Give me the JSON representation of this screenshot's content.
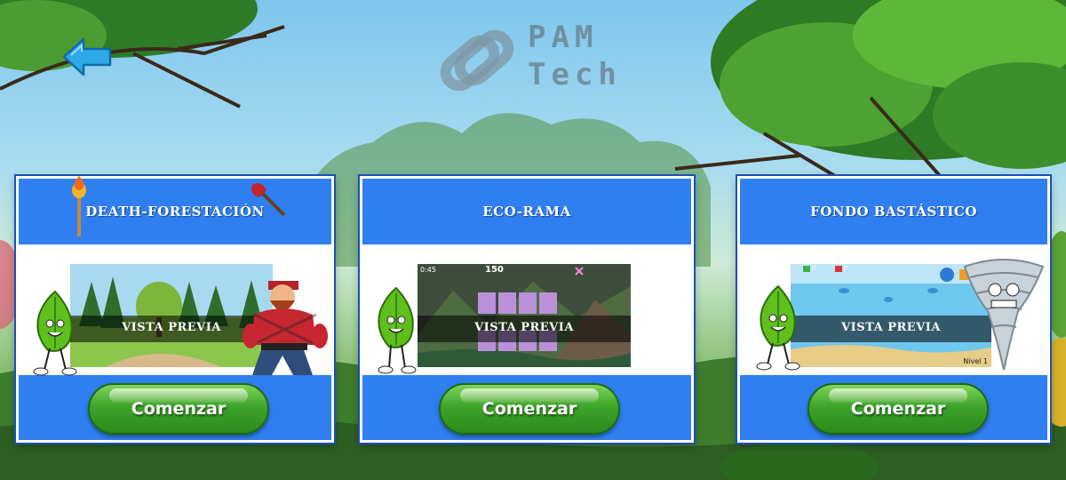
{
  "logo": {
    "line1": "PAM",
    "line2": "Tech"
  },
  "back_icon": "left-arrow-icon",
  "games": [
    {
      "title": "DEATH-FORESTACIÓN",
      "preview_label": "VISTA PREVIA",
      "button_label": "Comenzar"
    },
    {
      "title": "ECO-RAMA",
      "preview_label": "VISTA PREVIA",
      "button_label": "Comenzar",
      "hud": {
        "time": "0:45",
        "score": "150"
      }
    },
    {
      "title": "FONDO BASTÁSTICO",
      "preview_label": "VISTA PREVIA",
      "button_label": "Comenzar",
      "hud": {
        "counter_a": "0",
        "counter_b": "0",
        "level": "Nivel 1"
      }
    }
  ],
  "colors": {
    "card_blue": "#2f7ff0",
    "button_green": "#3ea42a",
    "arrow_blue": "#2fa8e8"
  }
}
